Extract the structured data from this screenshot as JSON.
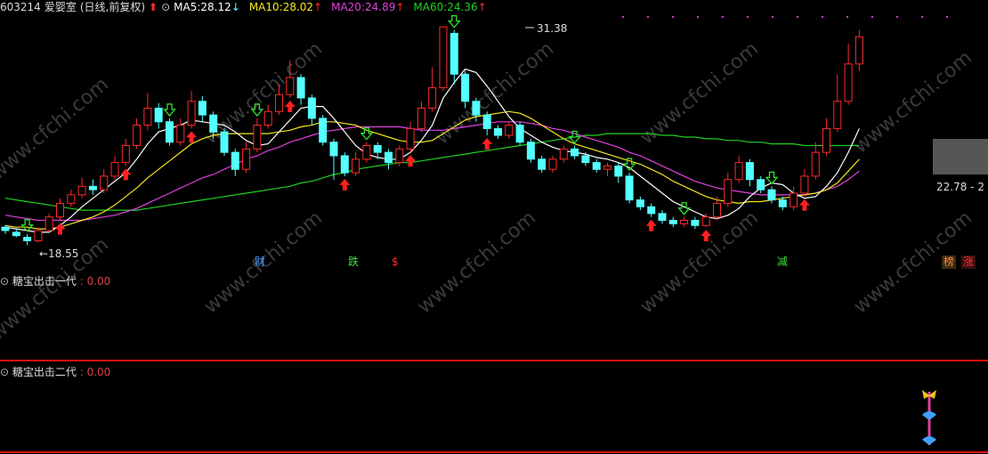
{
  "header": {
    "code": "603214",
    "name": "爱婴室",
    "mode": "(日线,前复权)",
    "ma5_label": "MA5:",
    "ma5": "28.12",
    "ma5_arrow": "↓",
    "ma10_label": "MA10:",
    "ma10": "28.02",
    "ma10_arrow": "↑",
    "ma20_label": "MA20:",
    "ma20": "24.89",
    "ma20_arrow": "↑",
    "ma60_label": "MA60:",
    "ma60": "24.36",
    "ma60_arrow": "↑"
  },
  "colors": {
    "up": "#ff2a2a",
    "down": "#54ffff",
    "ma5": "#ffffff",
    "ma10": "#f5e61e",
    "ma20": "#e040e0",
    "ma60": "#20d020",
    "panel_divider": "#e01010"
  },
  "annotations": {
    "high": "31.38",
    "low": "←18.55",
    "right_price": "22.78 - 2"
  },
  "tags": [
    {
      "text": "财",
      "color": "#4aa0ff"
    },
    {
      "text": "跌",
      "color": "#40e040"
    },
    {
      "text": "$",
      "color": "#ff3030"
    },
    {
      "text": "减",
      "color": "#40e040"
    },
    {
      "text": "榜",
      "color": "#ff8040"
    },
    {
      "text": "涨",
      "color": "#ff3030"
    }
  ],
  "panels": [
    {
      "name": "糖宝出击一代",
      "value": "0.00"
    },
    {
      "name": "糖宝出击二代",
      "value": "0.00"
    }
  ],
  "watermark": "www.cfchi.com",
  "chart_data": {
    "type": "candlestick",
    "series_names": [
      "MA5",
      "MA10",
      "MA20",
      "MA60"
    ],
    "candles": [
      [
        19.6,
        19.4,
        19.7,
        19.2
      ],
      [
        19.3,
        19.1,
        19.5,
        19.0
      ],
      [
        19.0,
        18.8,
        19.2,
        18.55
      ],
      [
        18.8,
        19.4,
        19.6,
        18.7
      ],
      [
        19.4,
        20.2,
        20.4,
        19.3
      ],
      [
        20.2,
        21.0,
        21.3,
        20.0
      ],
      [
        21.0,
        21.5,
        21.8,
        20.8
      ],
      [
        21.5,
        22.0,
        22.5,
        21.3
      ],
      [
        22.0,
        21.8,
        22.4,
        21.5
      ],
      [
        21.8,
        22.6,
        23.0,
        21.6
      ],
      [
        22.6,
        23.4,
        23.8,
        22.4
      ],
      [
        23.4,
        24.4,
        24.8,
        23.2
      ],
      [
        24.4,
        25.6,
        26.0,
        24.2
      ],
      [
        25.6,
        26.6,
        27.5,
        25.3
      ],
      [
        26.6,
        25.8,
        26.9,
        25.4
      ],
      [
        25.8,
        24.6,
        26.0,
        24.4
      ],
      [
        24.6,
        25.6,
        26.0,
        24.4
      ],
      [
        25.6,
        27.0,
        27.6,
        25.4
      ],
      [
        27.0,
        26.2,
        27.3,
        25.8
      ],
      [
        26.2,
        25.2,
        26.4,
        24.8
      ],
      [
        25.2,
        24.0,
        25.4,
        23.8
      ],
      [
        24.0,
        23.0,
        24.2,
        22.6
      ],
      [
        23.0,
        24.2,
        24.6,
        22.8
      ],
      [
        24.2,
        25.6,
        26.0,
        24.0
      ],
      [
        25.6,
        26.4,
        26.8,
        25.4
      ],
      [
        26.4,
        27.4,
        28.0,
        26.2
      ],
      [
        27.4,
        28.4,
        29.4,
        27.2
      ],
      [
        28.4,
        27.2,
        28.6,
        26.8
      ],
      [
        27.2,
        26.0,
        27.4,
        25.6
      ],
      [
        26.0,
        24.6,
        26.2,
        24.4
      ],
      [
        24.6,
        23.8,
        24.8,
        22.4
      ],
      [
        23.8,
        22.8,
        24.0,
        22.6
      ],
      [
        22.8,
        23.6,
        24.0,
        22.6
      ],
      [
        23.6,
        24.4,
        24.6,
        23.4
      ],
      [
        24.4,
        24.0,
        24.6,
        23.6
      ],
      [
        24.0,
        23.4,
        24.2,
        23.0
      ],
      [
        23.4,
        24.2,
        24.4,
        23.2
      ],
      [
        24.2,
        25.4,
        25.8,
        24.0
      ],
      [
        25.4,
        26.6,
        27.0,
        25.2
      ],
      [
        26.6,
        27.8,
        29.0,
        26.4
      ],
      [
        27.8,
        31.38,
        31.4,
        27.6
      ],
      [
        31.0,
        28.6,
        31.2,
        28.0
      ],
      [
        28.6,
        27.0,
        28.8,
        26.6
      ],
      [
        27.0,
        26.2,
        27.2,
        25.8
      ],
      [
        26.2,
        25.4,
        26.4,
        25.0
      ],
      [
        25.4,
        25.0,
        25.6,
        24.8
      ],
      [
        25.0,
        25.6,
        25.8,
        24.8
      ],
      [
        25.6,
        24.6,
        25.8,
        24.4
      ],
      [
        24.6,
        23.6,
        24.8,
        23.4
      ],
      [
        23.6,
        23.0,
        23.8,
        22.8
      ],
      [
        23.0,
        23.6,
        23.8,
        22.8
      ],
      [
        23.6,
        24.2,
        24.4,
        23.4
      ],
      [
        24.2,
        23.8,
        24.4,
        23.6
      ],
      [
        23.8,
        23.4,
        24.0,
        23.2
      ],
      [
        23.4,
        23.0,
        23.6,
        22.8
      ],
      [
        23.0,
        23.2,
        23.4,
        22.6
      ],
      [
        23.2,
        22.6,
        23.4,
        22.2
      ],
      [
        22.6,
        21.2,
        22.8,
        21.0
      ],
      [
        21.2,
        20.8,
        21.4,
        20.6
      ],
      [
        20.8,
        20.4,
        21.0,
        20.2
      ],
      [
        20.4,
        20.0,
        20.6,
        19.8
      ],
      [
        20.0,
        19.8,
        20.2,
        19.6
      ],
      [
        19.8,
        20.0,
        20.2,
        19.6
      ],
      [
        20.0,
        19.7,
        20.2,
        19.5
      ],
      [
        19.7,
        20.2,
        20.4,
        19.6
      ],
      [
        20.2,
        21.0,
        21.4,
        20.0
      ],
      [
        21.0,
        22.4,
        22.8,
        20.8
      ],
      [
        22.4,
        23.4,
        23.8,
        22.2
      ],
      [
        23.4,
        22.4,
        23.6,
        22.0
      ],
      [
        22.4,
        21.8,
        22.6,
        21.6
      ],
      [
        21.8,
        21.2,
        22.0,
        21.0
      ],
      [
        21.2,
        20.8,
        21.4,
        20.6
      ],
      [
        20.8,
        21.6,
        22.0,
        20.6
      ],
      [
        21.6,
        22.6,
        23.0,
        21.4
      ],
      [
        22.6,
        24.0,
        24.6,
        22.4
      ],
      [
        24.0,
        25.4,
        26.0,
        23.8
      ],
      [
        25.4,
        27.0,
        28.6,
        25.2
      ],
      [
        27.0,
        29.2,
        30.4,
        26.8
      ],
      [
        29.2,
        30.8,
        31.2,
        28.8
      ]
    ],
    "ma5": [
      19.6,
      19.5,
      19.4,
      19.3,
      19.3,
      19.7,
      20.2,
      20.8,
      21.3,
      21.8,
      22.3,
      22.8,
      23.6,
      24.5,
      25.2,
      25.4,
      25.6,
      25.9,
      25.8,
      25.7,
      25.6,
      25.2,
      24.7,
      24.4,
      24.5,
      25.2,
      25.9,
      26.6,
      26.7,
      26.7,
      26.0,
      25.2,
      24.4,
      23.9,
      23.7,
      23.6,
      23.6,
      24.0,
      24.7,
      25.6,
      27.2,
      28.1,
      28.9,
      28.7,
      27.9,
      27.0,
      26.1,
      25.4,
      25.0,
      24.6,
      24.3,
      24.1,
      24.0,
      23.9,
      23.7,
      23.6,
      23.4,
      23.1,
      22.6,
      22.1,
      21.6,
      21.1,
      20.8,
      20.5,
      20.2,
      20.1,
      20.3,
      20.7,
      21.4,
      21.9,
      22.2,
      22.1,
      21.6,
      21.3,
      21.4,
      22.0,
      22.8,
      24.0,
      25.4
    ],
    "ma10": [
      19.7,
      19.6,
      19.6,
      19.5,
      19.5,
      19.6,
      19.8,
      20.0,
      20.2,
      20.5,
      20.9,
      21.4,
      21.9,
      22.5,
      23.0,
      23.5,
      24.0,
      24.5,
      24.8,
      25.0,
      25.1,
      25.1,
      25.1,
      25.1,
      25.1,
      25.2,
      25.3,
      25.5,
      25.6,
      25.8,
      25.8,
      25.7,
      25.6,
      25.3,
      25.1,
      24.9,
      24.7,
      24.6,
      24.6,
      24.7,
      25.1,
      25.5,
      25.9,
      26.1,
      26.2,
      26.3,
      26.4,
      26.3,
      26.0,
      25.6,
      25.2,
      24.8,
      24.5,
      24.3,
      24.1,
      23.9,
      23.7,
      23.5,
      23.3,
      23.0,
      22.7,
      22.3,
      22.0,
      21.7,
      21.4,
      21.2,
      21.1,
      21.0,
      21.1,
      21.1,
      21.2,
      21.3,
      21.4,
      21.5,
      21.6,
      21.8,
      22.2,
      22.9,
      23.6
    ],
    "ma20": [
      20.3,
      20.2,
      20.1,
      20.0,
      20.0,
      20.0,
      20.0,
      20.0,
      20.1,
      20.2,
      20.3,
      20.5,
      20.7,
      21.0,
      21.3,
      21.6,
      21.9,
      22.2,
      22.5,
      22.7,
      23.0,
      23.3,
      23.6,
      23.8,
      24.1,
      24.3,
      24.6,
      24.8,
      25.0,
      25.2,
      25.3,
      25.4,
      25.5,
      25.5,
      25.5,
      25.5,
      25.5,
      25.4,
      25.3,
      25.3,
      25.3,
      25.4,
      25.5,
      25.6,
      25.7,
      25.8,
      25.8,
      25.8,
      25.7,
      25.6,
      25.4,
      25.3,
      25.1,
      24.9,
      24.7,
      24.5,
      24.3,
      24.0,
      23.8,
      23.5,
      23.2,
      22.9,
      22.6,
      22.3,
      22.1,
      21.9,
      21.8,
      21.7,
      21.6,
      21.5,
      21.5,
      21.5,
      21.5,
      21.5,
      21.6,
      21.8,
      22.0,
      22.4,
      22.9
    ],
    "ma60": [
      21.3,
      21.2,
      21.1,
      21.0,
      20.9,
      20.8,
      20.7,
      20.6,
      20.6,
      20.6,
      20.6,
      20.6,
      20.6,
      20.7,
      20.8,
      20.9,
      21.0,
      21.1,
      21.2,
      21.3,
      21.4,
      21.5,
      21.6,
      21.7,
      21.8,
      21.9,
      22.0,
      22.2,
      22.3,
      22.5,
      22.7,
      22.8,
      23.0,
      23.1,
      23.2,
      23.3,
      23.4,
      23.4,
      23.5,
      23.6,
      23.7,
      23.8,
      23.9,
      24.0,
      24.1,
      24.2,
      24.3,
      24.4,
      24.5,
      24.6,
      24.7,
      24.8,
      24.9,
      25.0,
      25.0,
      25.1,
      25.1,
      25.1,
      25.1,
      25.1,
      25.0,
      25.0,
      24.9,
      24.9,
      24.8,
      24.8,
      24.7,
      24.7,
      24.6,
      24.6,
      24.5,
      24.5,
      24.5,
      24.4,
      24.4,
      24.4,
      24.4,
      24.4,
      24.4
    ]
  }
}
